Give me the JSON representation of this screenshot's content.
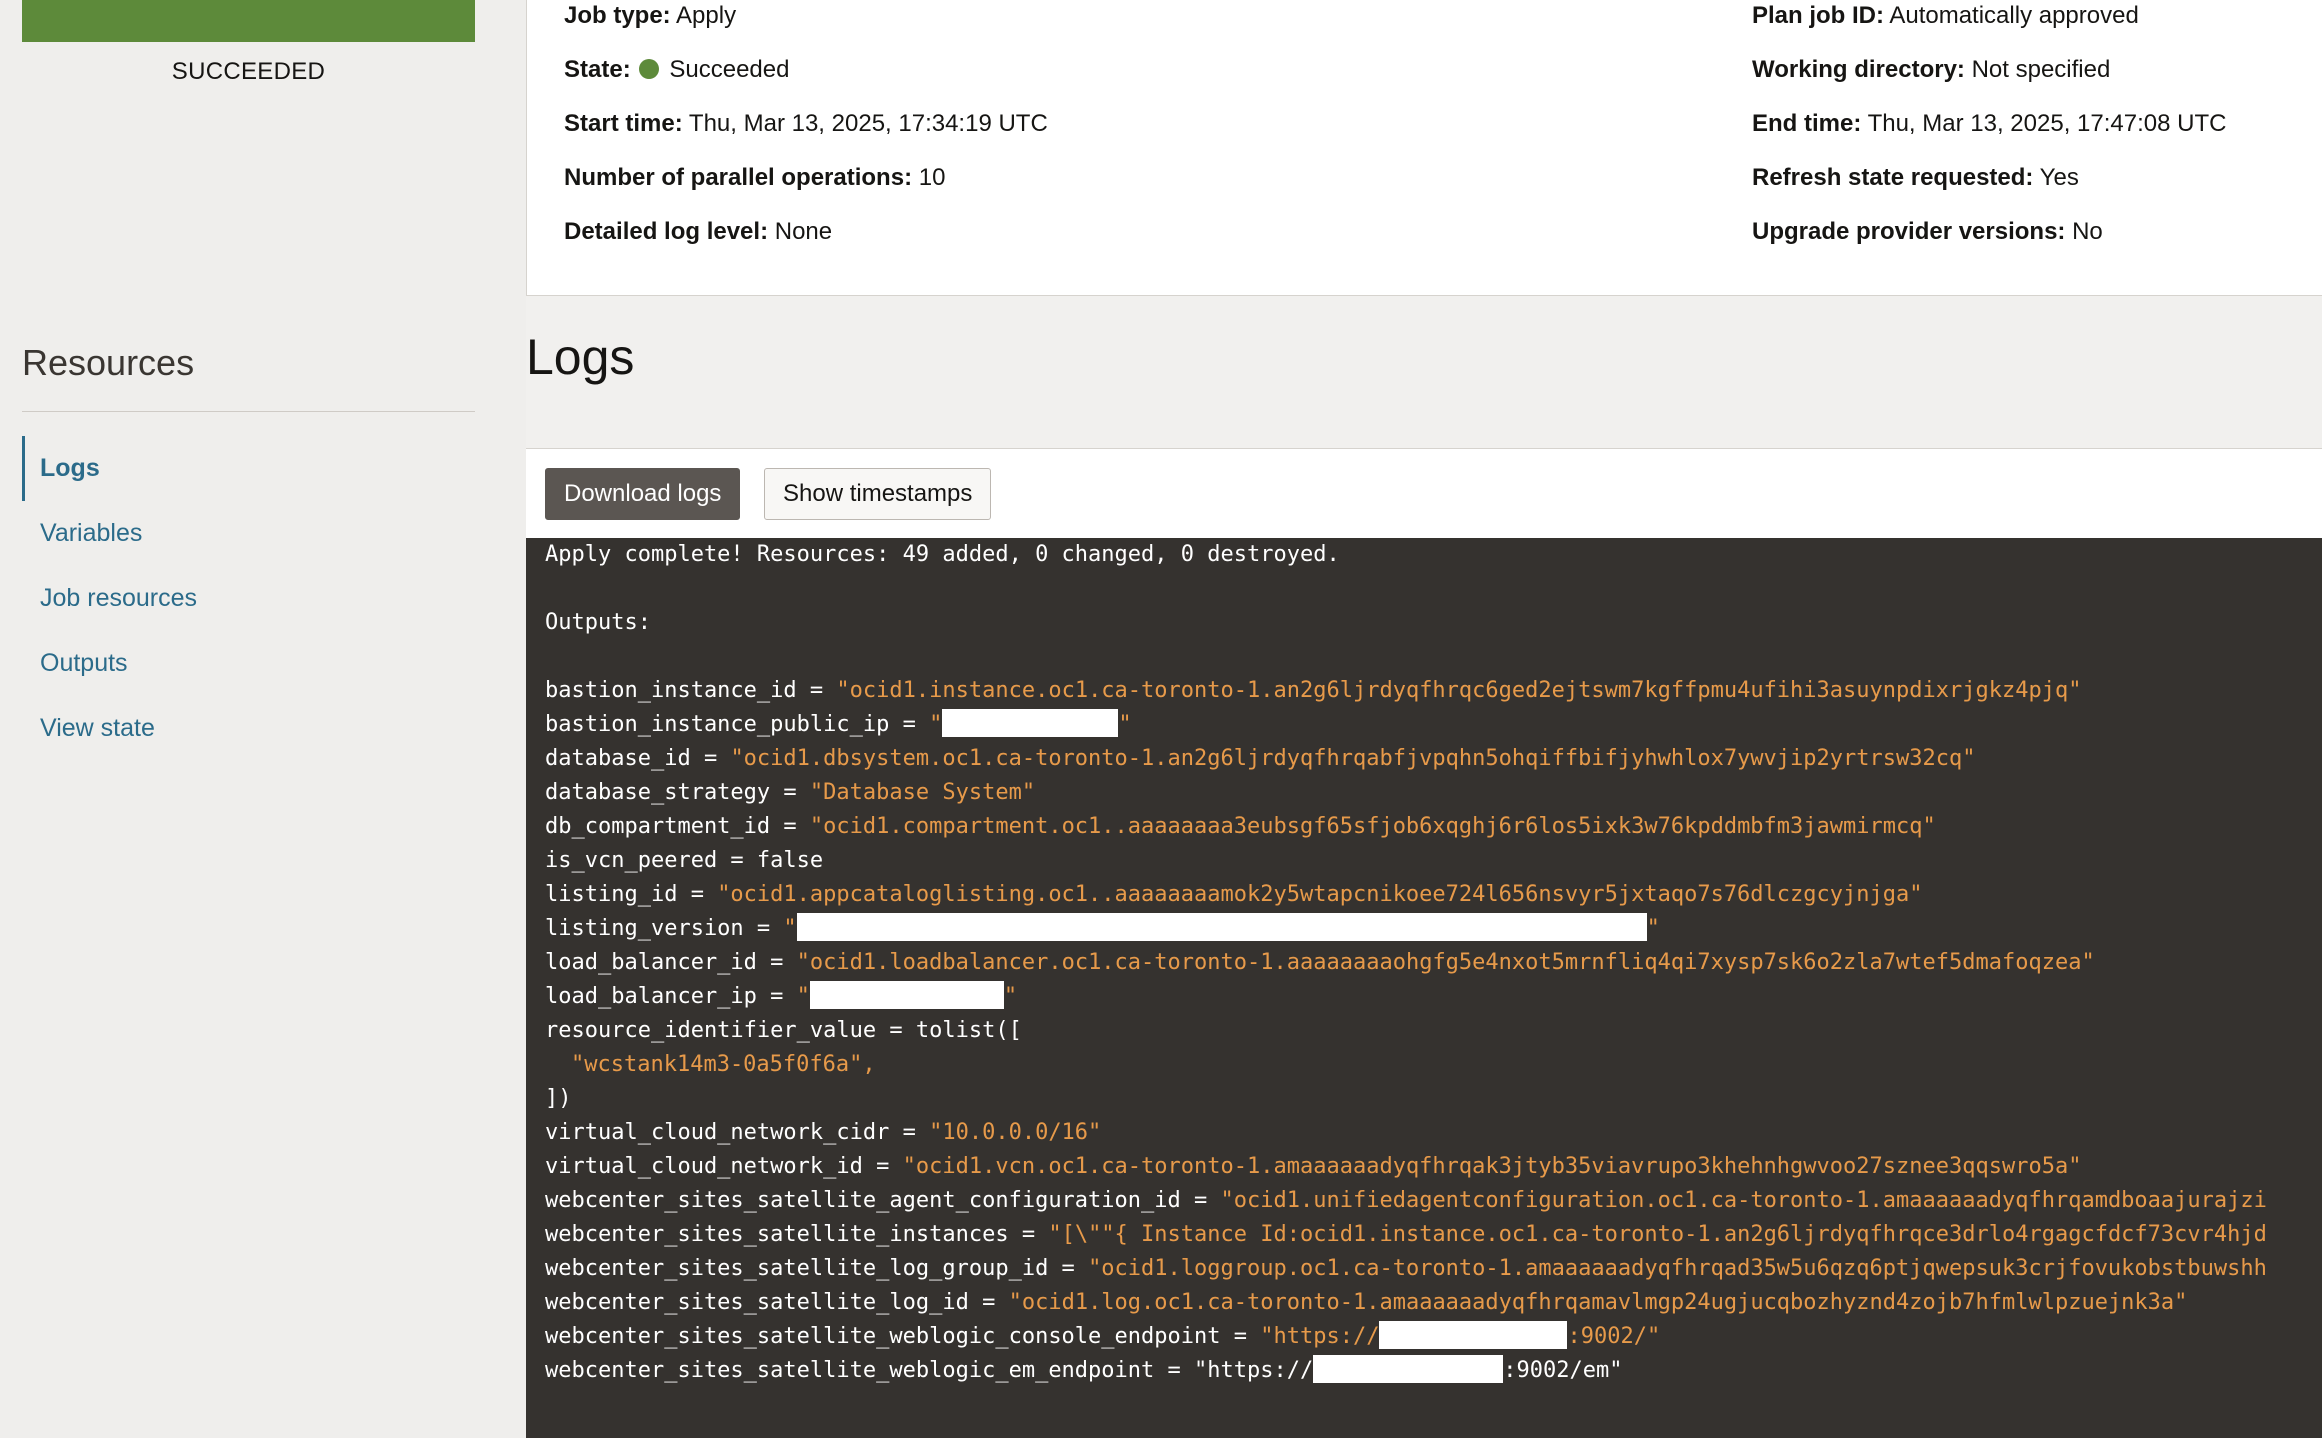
{
  "sidebar": {
    "status_label": "SUCCEEDED",
    "status_color": "#5d8a3a",
    "resources_title": "Resources",
    "items": [
      {
        "label": "Logs",
        "active": true
      },
      {
        "label": "Variables"
      },
      {
        "label": "Job resources"
      },
      {
        "label": "Outputs"
      },
      {
        "label": "View state"
      }
    ]
  },
  "details": {
    "job_type": {
      "label": "Job type:",
      "value": "Apply"
    },
    "state": {
      "label": "State:",
      "value": "Succeeded"
    },
    "start_time": {
      "label": "Start time:",
      "value": "Thu, Mar 13, 2025, 17:34:19 UTC"
    },
    "parallel_ops": {
      "label": "Number of parallel operations:",
      "value": "10"
    },
    "log_level": {
      "label": "Detailed log level:",
      "value": "None"
    },
    "plan_job_id": {
      "label": "Plan job ID:",
      "value": "Automatically approved"
    },
    "working_dir": {
      "label": "Working directory:",
      "value": "Not specified"
    },
    "end_time": {
      "label": "End time:",
      "value": "Thu, Mar 13, 2025, 17:47:08 UTC"
    },
    "refresh_state": {
      "label": "Refresh state requested:",
      "value": "Yes"
    },
    "upgrade_provider": {
      "label": "Upgrade provider versions:",
      "value": "No"
    }
  },
  "logs": {
    "heading": "Logs",
    "download_label": "Download logs",
    "timestamps_label": "Show timestamps"
  },
  "console": {
    "apply_complete": "Apply complete! Resources: 49 added, 0 changed, 0 destroyed.",
    "outputs_label": "Outputs:",
    "bastion_instance_id": {
      "key": "bastion_instance_id = ",
      "value": "\"ocid1.instance.oc1.ca-toronto-1.an2g6ljrdyqfhrqc6ged2ejtswm7kgffpmu4ufihi3asuynpdixrjgkz4pjq\""
    },
    "bastion_instance_public_ip": {
      "key": "bastion_instance_public_ip = ",
      "open": "\"",
      "close": "\""
    },
    "database_id": {
      "key": "database_id = ",
      "value": "\"ocid1.dbsystem.oc1.ca-toronto-1.an2g6ljrdyqfhrqabfjvpqhn5ohqiffbifjyhwhlox7ywvjip2yrtrsw32cq\""
    },
    "database_strategy": {
      "key": "database_strategy = ",
      "value": "\"Database System\""
    },
    "db_compartment_id": {
      "key": "db_compartment_id = ",
      "value": "\"ocid1.compartment.oc1..aaaaaaaa3eubsgf65sfjob6xqghj6r6los5ixk3w76kpddmbfm3jawmirmcq\""
    },
    "is_vcn_peered": "is_vcn_peered = false",
    "listing_id": {
      "key": "listing_id = ",
      "value": "\"ocid1.appcataloglisting.oc1..aaaaaaaamok2y5wtapcnikoee724l656nsvyr5jxtaqo7s76dlczgcyjnjga\""
    },
    "listing_version": {
      "key": "listing_version = ",
      "open": "\"",
      "close": "\""
    },
    "load_balancer_id": {
      "key": "load_balancer_id = ",
      "value": "\"ocid1.loadbalancer.oc1.ca-toronto-1.aaaaaaaaohgfg5e4nxot5mrnfliq4qi7xysp7sk6o2zla7wtef5dmafoqzea\""
    },
    "load_balancer_ip": {
      "key": "load_balancer_ip = ",
      "open": "\"",
      "close": "\""
    },
    "resource_identifier_open": "resource_identifier_value = tolist([",
    "resource_identifier_item": "\"wcstank14m3-0a5f0f6a\",",
    "resource_identifier_close": "])",
    "vcn_cidr": {
      "key": "virtual_cloud_network_cidr = ",
      "value": "\"10.0.0.0/16\""
    },
    "vcn_id": {
      "key": "virtual_cloud_network_id = ",
      "value": "\"ocid1.vcn.oc1.ca-toronto-1.amaaaaaadyqfhrqak3jtyb35viavrupo3khehnhgwvoo27sznee3qqswro5a\""
    },
    "agent_config_id": {
      "key": "webcenter_sites_satellite_agent_configuration_id = ",
      "value": "\"ocid1.unifiedagentconfiguration.oc1.ca-toronto-1.amaaaaaadyqfhrqamdboaajurajzi"
    },
    "instances": {
      "key": "webcenter_sites_satellite_instances = ",
      "value": "\"[\\\"\"{ Instance Id:ocid1.instance.oc1.ca-toronto-1.an2g6ljrdyqfhrqce3drlo4rgagcfdcf73cvr4hjd"
    },
    "log_group_id": {
      "key": "webcenter_sites_satellite_log_group_id = ",
      "value": "\"ocid1.loggroup.oc1.ca-toronto-1.amaaaaaadyqfhrqad35w5u6qzq6ptjqwepsuk3crjfovukobstbuwshh"
    },
    "log_id": {
      "key": "webcenter_sites_satellite_log_id = ",
      "value": "\"ocid1.log.oc1.ca-toronto-1.amaaaaaadyqfhrqamavlmgp24ugjucqbozhyznd4zojb7hfmlwlpzuejnk3a\""
    },
    "console_endpoint": {
      "key": "webcenter_sites_satellite_weblogic_console_endpoint = ",
      "open": "\"https://",
      "close": ":9002/\""
    },
    "em_endpoint": {
      "key": "webcenter_sites_satellite_weblogic_em_endpoint = ",
      "open": "\"https://",
      "close": ":9002/em\""
    }
  }
}
